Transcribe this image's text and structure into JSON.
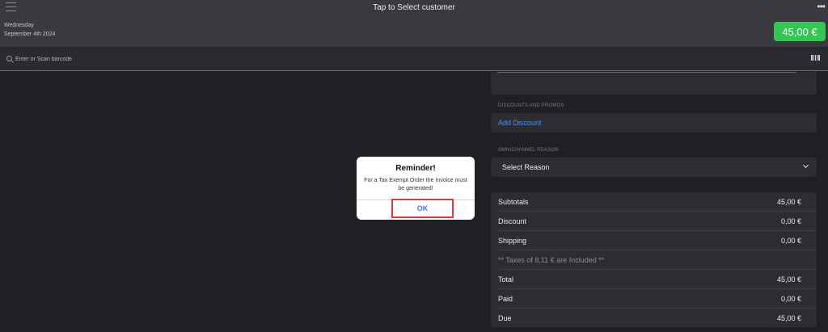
{
  "header": {
    "title": "Tap to Select customer",
    "day": "Wednesday",
    "date": "September 4th 2024",
    "total_amount": "45,00 €",
    "more_glyph": "•••"
  },
  "search": {
    "placeholder": "Enter or Scan barcode"
  },
  "panel": {
    "discounts_label": "DISCOUNTS AND PROMOS",
    "add_discount": "Add Discount",
    "omnichannel_label": "OMNICHANNEL REASON",
    "select_reason": "Select Reason"
  },
  "totals": [
    {
      "label": "Subtotals",
      "value": "45,00 €"
    },
    {
      "label": "Discount",
      "value": "0,00 €"
    },
    {
      "label": "Shipping",
      "value": "0,00 €"
    },
    {
      "label": "** Taxes of 8,11 € are Included **",
      "value": ""
    },
    {
      "label": "Total",
      "value": "45,00 €"
    },
    {
      "label": "Paid",
      "value": "0,00 €"
    },
    {
      "label": "Due",
      "value": "45,00 €"
    }
  ],
  "dialog": {
    "title": "Reminder!",
    "message": "For a Tax Exempt Order the Invoice must be generated!",
    "ok_label": "OK"
  },
  "colors": {
    "accent_green": "#34c554",
    "link_blue": "#4a94ee",
    "highlight_red": "#e0373b"
  }
}
